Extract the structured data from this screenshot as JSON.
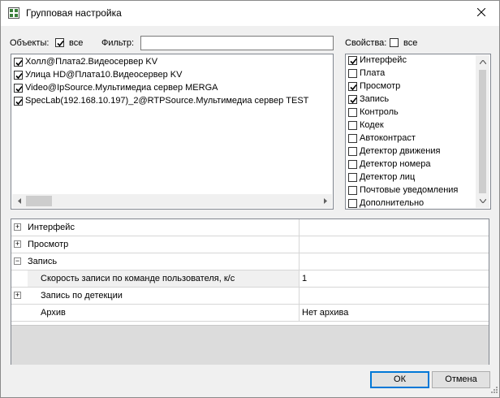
{
  "window": {
    "title": "Групповая настройка"
  },
  "objects": {
    "label": "Объекты:",
    "all_label": "все",
    "all_checked": true,
    "filter_label": "Фильтр:",
    "filter_value": "",
    "items": [
      {
        "label": "Холл@Плата2.Видеосервер KV",
        "checked": true
      },
      {
        "label": "Улица HD@Плата10.Видеосервер KV",
        "checked": true
      },
      {
        "label": "Video@IpSource.Мультимедиа сервер MERGA",
        "checked": true
      },
      {
        "label": "SpecLab(192.168.10.197)_2@RTPSource.Мультимедиа сервер TEST",
        "checked": true
      }
    ]
  },
  "properties": {
    "label": "Свойства:",
    "all_label": "все",
    "all_checked": false,
    "items": [
      {
        "label": "Интерфейс",
        "checked": true
      },
      {
        "label": "Плата",
        "checked": false
      },
      {
        "label": "Просмотр",
        "checked": true
      },
      {
        "label": "Запись",
        "checked": true
      },
      {
        "label": "Контроль",
        "checked": false
      },
      {
        "label": "Кодек",
        "checked": false
      },
      {
        "label": "Автоконтраст",
        "checked": false
      },
      {
        "label": "Детектор движения",
        "checked": false
      },
      {
        "label": "Детектор номера",
        "checked": false
      },
      {
        "label": "Детектор лиц",
        "checked": false
      },
      {
        "label": "Почтовые уведомления",
        "checked": false
      },
      {
        "label": "Дополнительно",
        "checked": false
      }
    ]
  },
  "grid": {
    "rows": [
      {
        "name": "Интерфейс",
        "value": "",
        "expander": "+",
        "level": 0
      },
      {
        "name": "Просмотр",
        "value": "",
        "expander": "+",
        "level": 0
      },
      {
        "name": "Запись",
        "value": "",
        "expander": "−",
        "level": 0
      },
      {
        "name": "Скорость записи по команде пользователя, к/с",
        "value": "1",
        "expander": "",
        "level": 1
      },
      {
        "name": "Запись по детекции",
        "value": "",
        "expander": "+",
        "level": 1
      },
      {
        "name": "Архив",
        "value": "Нет архива",
        "expander": "",
        "level": 1
      }
    ]
  },
  "buttons": {
    "ok": "ОК",
    "cancel": "Отмена"
  }
}
